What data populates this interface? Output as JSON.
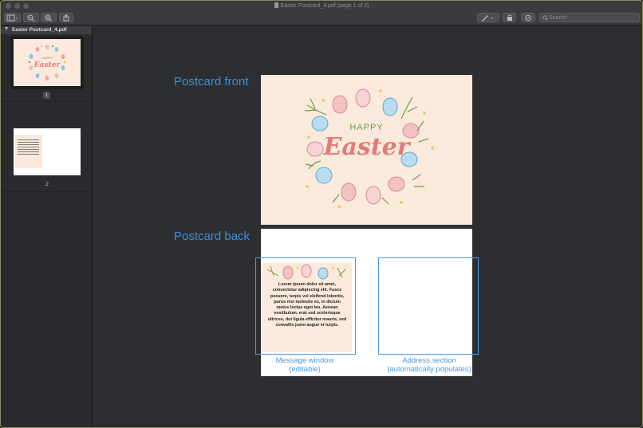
{
  "window": {
    "title": "Easter Postcard_4.pdf",
    "page_indicator": "(page 1 of 2)"
  },
  "toolbar": {
    "search_placeholder": "Search"
  },
  "sidebar": {
    "header": "Easter Postcard_4.pdf",
    "pages": [
      {
        "number": "1",
        "selected": true
      },
      {
        "number": "2",
        "selected": false
      }
    ]
  },
  "annotations": {
    "front_label": "Postcard front",
    "back_label": "Postcard back",
    "message_caption_line1": "Message window",
    "message_caption_line2": "(editable)",
    "address_caption_line1": "Address section",
    "address_caption_line2": "(automatically populates)"
  },
  "postcard": {
    "happy": "HAPPY",
    "easter": "Easter",
    "message_text": "Lorem ipsum dolor sit amet, consectetur adipiscing elit. Fusce posuere, turpis vel eleifend lobortis, purus nisi molestie ex, in dictum metus lectus eget leo. Aenean vestibulum, erat sed scelerisque ultrices, dui ligula efficitur mauris, sed convallis justo augue et turpis."
  },
  "colors": {
    "accent_blue": "#3d8fdf",
    "card_bg": "#faeadb",
    "easter_pink": "#e27a7b",
    "happy_green": "#6f9a4d"
  }
}
